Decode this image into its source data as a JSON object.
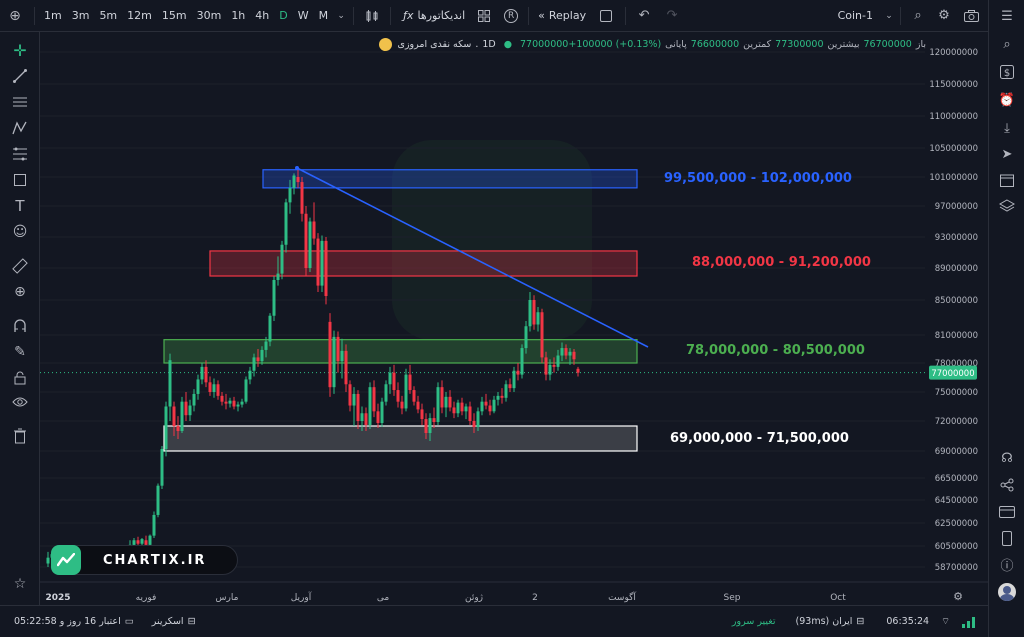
{
  "toolbar": {
    "timeframes": [
      "1m",
      "3m",
      "5m",
      "12m",
      "15m",
      "30m",
      "1h",
      "4h",
      "D",
      "W",
      "M"
    ],
    "active_timeframe": "D",
    "indicators_label": "اندیکاتورها",
    "replay_label": "Replay",
    "layout_name": "Coin-1"
  },
  "symbol": {
    "name": "سکه نقدی امروزی",
    "interval": "1D",
    "open_label": "باز",
    "open": "76700000",
    "high_label": "بیشترین",
    "high": "77300000",
    "low_label": "کمترین",
    "low": "76600000",
    "close_label": "پایانی",
    "close_change": "77000000+100000 (+0.13%)"
  },
  "price_axis": {
    "ticks": [
      "120000000",
      "115000000",
      "110000000",
      "105000000",
      "101000000",
      "97000000",
      "93000000",
      "89000000",
      "85000000",
      "81000000",
      "78000000",
      "75000000",
      "72000000",
      "69000000",
      "66500000",
      "64500000",
      "62500000",
      "60500000",
      "58700000"
    ],
    "current_price": "77000000"
  },
  "time_axis": {
    "labels": [
      "2025",
      "فوریه",
      "مارس",
      "آوریل",
      "می",
      "ژوئن",
      "2",
      "آگوست",
      "Sep",
      "Oct"
    ]
  },
  "zones": [
    {
      "label": "99,500,000 - 102,000,000",
      "low": 99500000,
      "high": 102000000,
      "color": "#2962ff"
    },
    {
      "label": "88,000,000 - 91,200,000",
      "low": 88000000,
      "high": 91200000,
      "color": "#f23645"
    },
    {
      "label": "78,000,000 - 80,500,000",
      "low": 78000000,
      "high": 80500000,
      "color": "#4caf50"
    },
    {
      "label": "69,000,000 - 71,500,000",
      "low": 69000000,
      "high": 71500000,
      "color": "#ffffff"
    }
  ],
  "brand": {
    "name": "CHARTIX.IR"
  },
  "bottom": {
    "time": "06:35:24",
    "server": "ایران (93ms)",
    "change_server": "تغییر سرور",
    "screener": "اسکرینر",
    "credit": "اعتبار 16 روز و 05:22:58"
  },
  "colors": {
    "up": "#2ebd85",
    "down": "#f23645",
    "trend": "#2962ff"
  }
}
